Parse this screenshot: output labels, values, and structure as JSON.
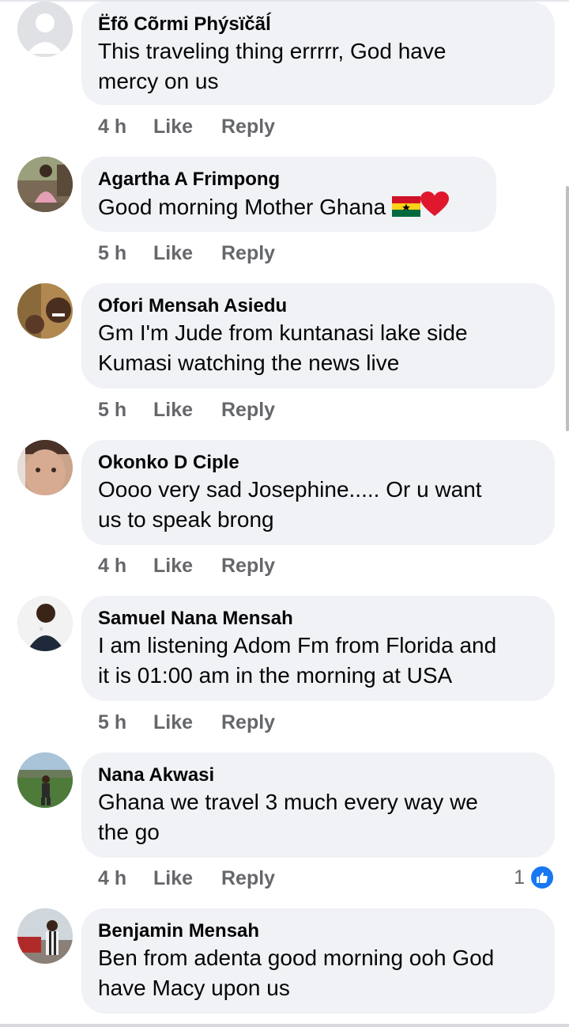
{
  "comments": [
    {
      "name": "Ëfõ Cõrmi Phýsïčãĺ",
      "lines": [
        "This traveling thing errrrr,  God have",
        "mercy on us"
      ],
      "time": "4 h",
      "like": "Like",
      "reply": "Reply",
      "avatar": "default-avatar-icon"
    },
    {
      "name": "Agartha A Frimpong",
      "lines": [
        "Good morning Mother Ghana"
      ],
      "emojis": [
        "ghana-flag-icon",
        "red-heart-icon"
      ],
      "time": "5 h",
      "like": "Like",
      "reply": "Reply",
      "avatar": "user-photo"
    },
    {
      "name": "Ofori Mensah Asiedu",
      "lines": [
        "Gm I'm Jude from kuntanasi lake side",
        "Kumasi watching the news live"
      ],
      "time": "5 h",
      "like": "Like",
      "reply": "Reply",
      "avatar": "user-photo"
    },
    {
      "name": "Okonko D Ciple",
      "lines": [
        "Oooo very sad Josephine..... Or u want",
        "us to speak brong"
      ],
      "time": "4 h",
      "like": "Like",
      "reply": "Reply",
      "avatar": "user-photo"
    },
    {
      "name": "Samuel Nana Mensah",
      "lines": [
        "I am listening Adom Fm from Florida and",
        "it is 01:00 am in the morning at USA"
      ],
      "time": "5 h",
      "like": "Like",
      "reply": "Reply",
      "avatar": "user-photo"
    },
    {
      "name": "Nana Akwasi",
      "lines": [
        "Ghana we travel 3 much every way we",
        "the go"
      ],
      "time": "4 h",
      "like": "Like",
      "reply": "Reply",
      "reaction_count": "1",
      "reaction_icon": "thumbs-up-icon",
      "avatar": "user-photo"
    },
    {
      "name": "Benjamin Mensah",
      "lines": [
        "Ben from adenta good morning ooh God",
        "have Macy upon us"
      ],
      "avatar": "user-photo"
    }
  ],
  "colors": {
    "bubble": "#f0f2f5",
    "name_text": "#050505",
    "meta_text": "#65676b",
    "like_badge": "#1877f2"
  }
}
